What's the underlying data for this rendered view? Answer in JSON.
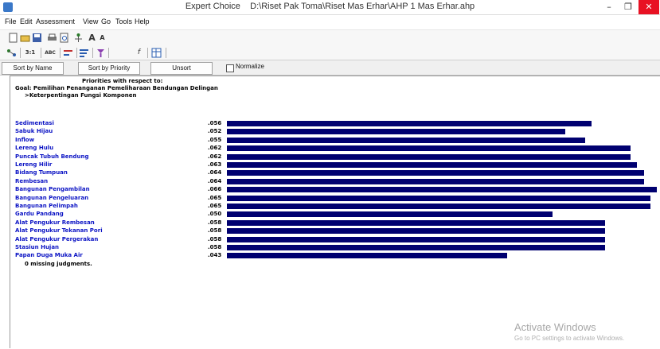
{
  "window": {
    "app_name": "Expert Choice",
    "file_path": "D:\\Riset Pak Toma\\Riset Mas Erhar\\AHP 1 Mas Erhar.ahp",
    "minimize": "–",
    "maximize": "❐",
    "close": "✕"
  },
  "menu": [
    "File",
    "Edit",
    "Assessment",
    "View",
    "Go",
    "Tools",
    "Help"
  ],
  "toolbar2_labels": {
    "ratio": "3:1",
    "abc": "ABC"
  },
  "sortbar": {
    "sort_name": "Sort by Name",
    "sort_priority": "Sort by Priority",
    "unsort": "Unsort",
    "normalize": "Normalize"
  },
  "header": {
    "priorities": "Priorities with respect to:",
    "goal": "Goal: Pemilihan Penanganan Pemeliharaan Bendungan Delingan",
    "criterion": ">Keterpentingan Fungsi Komponen"
  },
  "chart_data": {
    "type": "bar",
    "orientation": "horizontal",
    "categories": [
      "Sedimentasi",
      "Sabuk Hijau",
      "Inflow",
      "Lereng Hulu",
      "Puncak Tubuh Bendung",
      "Lereng Hilir",
      "Bidang Tumpuan",
      "Rembesan",
      "Bangunan Pengambilan",
      "Bangunan Pengeluaran",
      "Bangunan Pelimpah",
      "Gardu Pandang",
      "Alat Pengukur Rembesan",
      "Alat Pengukur Tekanan Pori",
      "Alat Pengukur Pergerakan",
      "Stasiun Hujan",
      "Papan Duga Muka Air"
    ],
    "labels": [
      ".056",
      ".052",
      ".055",
      ".062",
      ".062",
      ".063",
      ".064",
      ".064",
      ".066",
      ".065",
      ".065",
      ".050",
      ".058",
      ".058",
      ".058",
      ".058",
      ".043"
    ],
    "values": [
      0.056,
      0.052,
      0.055,
      0.062,
      0.062,
      0.063,
      0.064,
      0.064,
      0.066,
      0.065,
      0.065,
      0.05,
      0.058,
      0.058,
      0.058,
      0.058,
      0.043
    ],
    "bar_color": "#000070",
    "label_color": "#0b13c4"
  },
  "missing_judgments": "0  missing judgments.",
  "watermark": {
    "title": "Activate Windows",
    "subtitle": "Go to PC settings to activate Windows."
  }
}
